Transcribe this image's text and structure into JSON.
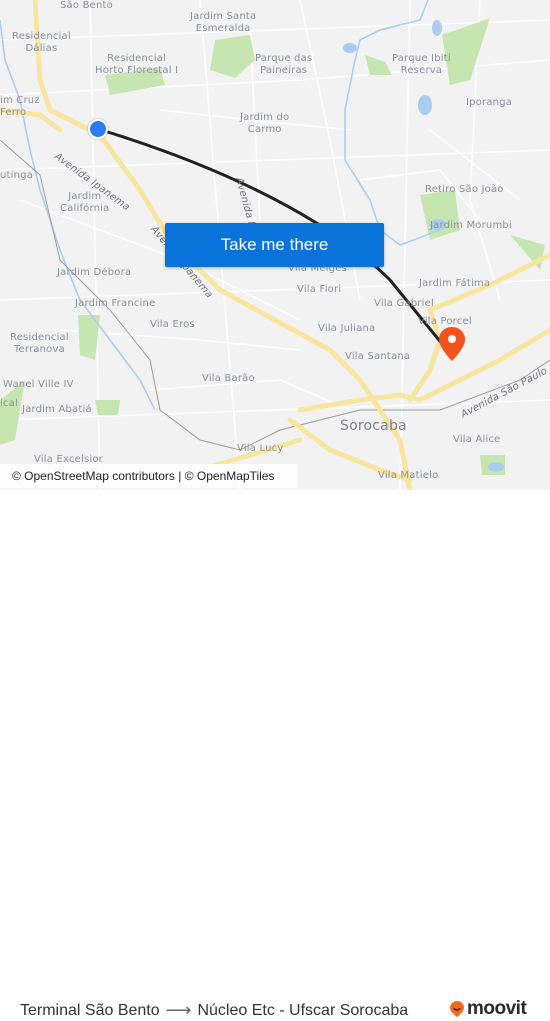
{
  "map": {
    "neighborhood_labels": [
      {
        "id": "sao-bento",
        "text": "São Bento"
      },
      {
        "id": "residencial-dalias",
        "text": "Residencial\nDálias"
      },
      {
        "id": "jardim-santa-esmeralda",
        "text": "Jardim Santa\nEsmeralda"
      },
      {
        "id": "residencial-horto-florestal",
        "text": "Residencial\nHorto Florestal I"
      },
      {
        "id": "parque-das-paineiras",
        "text": "Parque das\nPaineiras"
      },
      {
        "id": "parque-ibiti-reserva",
        "text": "Parque Ibiti\nReserva"
      },
      {
        "id": "jardim-cruz-ferro",
        "text": "im Cruz\nFerro"
      },
      {
        "id": "iporanga",
        "text": "Iporanga"
      },
      {
        "id": "jardim-do-carmo",
        "text": "Jardim do\nCarmo"
      },
      {
        "id": "utinga",
        "text": "utinga"
      },
      {
        "id": "retiro-sao-joao",
        "text": "Retiro São João"
      },
      {
        "id": "jardim-california",
        "text": "Jardim\nCalifórnia"
      },
      {
        "id": "jardim-morumbi",
        "text": "Jardim Morumbi"
      },
      {
        "id": "vila-melges",
        "text": "Vila Melges"
      },
      {
        "id": "jardim-debora",
        "text": "Jardim Débora"
      },
      {
        "id": "jardim-fatima",
        "text": "Jardim Fátima"
      },
      {
        "id": "vila-fiori",
        "text": "Vila Fiori"
      },
      {
        "id": "jardim-francine",
        "text": "Jardim Francine"
      },
      {
        "id": "vila-gabriel",
        "text": "Vila Gabriel"
      },
      {
        "id": "vila-porcel",
        "text": "Vila Porcel"
      },
      {
        "id": "vila-eros",
        "text": "Vila Eros"
      },
      {
        "id": "vila-juliana",
        "text": "Vila Juliana"
      },
      {
        "id": "residencial-terranova",
        "text": "Residencial\nTerranova"
      },
      {
        "id": "vila-santana",
        "text": "Vila Santana"
      },
      {
        "id": "wanel-ville",
        "text": "Wanel Ville IV"
      },
      {
        "id": "vila-barao",
        "text": "Vila Barão"
      },
      {
        "id": "jardim-abatia",
        "text": "Jardim Abatiá"
      },
      {
        "id": "ical",
        "text": "ical"
      },
      {
        "id": "vila-lucy",
        "text": "Vila Lucy"
      },
      {
        "id": "vila-alice",
        "text": "Vila Alice"
      },
      {
        "id": "vila-excelsior",
        "text": "Vila Excelsior"
      },
      {
        "id": "vila-matielo",
        "text": "Vila Matielo"
      }
    ],
    "city_label": "Sorocaba",
    "street_labels": {
      "avenida_ipanema_1": "Avenida Ipanema",
      "avenida_ipanema_2": "Avenida Ipanema",
      "avenida_itavuvu": "Avenida Ita",
      "avenida_sao_paulo": "Avenida São Paulo"
    },
    "origin_marker": "origin-dot",
    "destination_marker": "destination-pin",
    "colors": {
      "route_line": "#222222",
      "origin": "#2b7bf2",
      "destination": "#f4511e",
      "major_road": "#f8e6a0",
      "water": "#a9cdf0",
      "park": "#c5e6b0"
    }
  },
  "cta": {
    "label": "Take me there",
    "color": "#0a73d9"
  },
  "attribution": "© OpenStreetMap contributors | © OpenMapTiles",
  "footer": {
    "origin": "Terminal São Bento",
    "arrow": "⟶",
    "destination": "Núcleo Etc - Ufscar Sorocaba",
    "brand": "moovit",
    "brand_color": "#f26a21"
  }
}
